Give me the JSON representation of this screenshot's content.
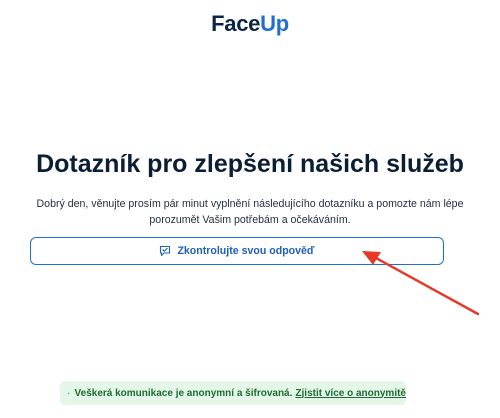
{
  "logo": {
    "part1": "Face",
    "part2": "Up"
  },
  "title": "Dotazník pro zlepšení našich služeb",
  "intro": "Dobrý den, věnujte prosím pár minut vyplnění následujícího dotazníku a pomozte nám lépe porozumět Vašim potřebám a očekáváním.",
  "check_button": {
    "label": "Zkontrolujte svou odpověď",
    "icon": "message-check-icon"
  },
  "security": {
    "icon": "shield-check-icon",
    "text": "Veškerá komunikace je anonymní a šifrovaná.",
    "link": "Zjistit více o anonymitě"
  },
  "colors": {
    "brand_blue": "#1f6fd1",
    "arrow_red": "#e53a2a",
    "secure_bg": "#e4f6e8",
    "secure_text": "#1e6b34"
  }
}
